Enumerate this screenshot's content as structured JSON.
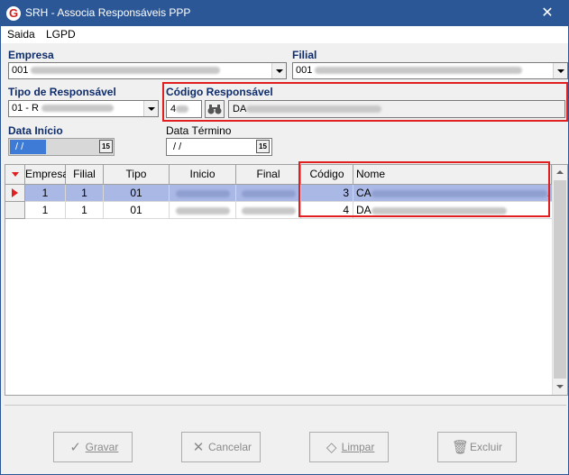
{
  "window": {
    "title": "SRH - Associa Responsáveis PPP",
    "close_glyph": "✕",
    "app_icon_glyph": "G"
  },
  "menu": [
    "Saida",
    "LGPD"
  ],
  "empresa": {
    "label": "Empresa",
    "value": "001"
  },
  "filial": {
    "label": "Filial",
    "value": "001"
  },
  "tipo_responsavel": {
    "label": "Tipo de Responsável",
    "value": "01 - R"
  },
  "codigo_responsavel": {
    "label": "Código Responsável",
    "code": "4",
    "name": "DA",
    "search_icon": "binoculars-icon"
  },
  "data_inicio": {
    "label": "Data Início",
    "value": " / /",
    "calendar": "15"
  },
  "data_termino": {
    "label": "Data Término",
    "value": " / /",
    "calendar": "15"
  },
  "grid": {
    "columns": [
      "Empresa",
      "Filial",
      "Tipo",
      "Inicio",
      "Final",
      "Código",
      "Nome"
    ],
    "rows": [
      {
        "empresa": "1",
        "filial": "1",
        "tipo": "01",
        "codigo": "3",
        "nome": "CA",
        "nome_tail": "."
      },
      {
        "empresa": "1",
        "filial": "1",
        "tipo": "01",
        "codigo": "4",
        "nome": "DA"
      }
    ]
  },
  "buttons": {
    "gravar": "Gravar",
    "cancelar": "Cancelar",
    "limpar": "Limpar",
    "excluir": "Excluir"
  },
  "colors": {
    "title_bar": "#2b5797",
    "highlight_box": "#e02020",
    "selected_row": "#aab8e6",
    "label_bold": "#0f2d6b"
  }
}
